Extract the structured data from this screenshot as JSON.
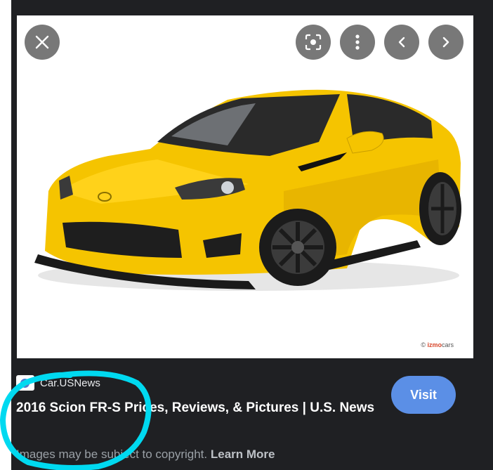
{
  "viewer": {
    "image_alt": "2016 Scion FR-S",
    "watermark_symbol": "©",
    "watermark_prefix": "izmo",
    "watermark_suffix": "cars",
    "controls": {
      "close_icon": "close-icon",
      "lens_icon": "lens-icon",
      "more_icon": "more-vert-icon",
      "prev_icon": "chevron-left-icon",
      "next_icon": "chevron-right-icon"
    }
  },
  "result": {
    "source": "Car.USNews",
    "title": "2016 Scion FR-S Prices, Reviews, & Pictures | U.S. News",
    "visit_label": "Visit",
    "copyright_text": "Images may be subject to copyright.",
    "learn_more_label": "Learn More"
  },
  "colors": {
    "background": "#202124",
    "visit_button": "#5b8fe6",
    "car_body": "#f5c400",
    "annotation": "#00d9f0"
  }
}
